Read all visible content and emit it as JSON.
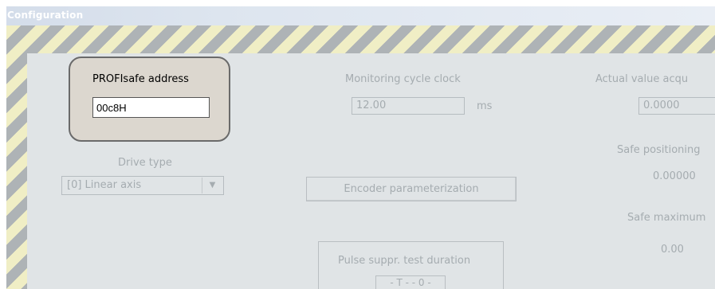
{
  "window": {
    "title": "Configuration"
  },
  "profisafe": {
    "label": "PROFIsafe address",
    "value": "00c8H"
  },
  "monitoring": {
    "label": "Monitoring cycle clock",
    "value": "12.00",
    "unit": "ms"
  },
  "actual_value": {
    "label": "Actual value acqu",
    "value": "0.0000"
  },
  "drive_type": {
    "label": "Drive type",
    "selected": "[0] Linear axis"
  },
  "encoder": {
    "button_label": "Encoder parameterization"
  },
  "safe_positioning": {
    "label": "Safe positioning",
    "value": "0.00000"
  },
  "safe_maximum": {
    "label": "Safe maximum",
    "value": "0.00"
  },
  "pulse_suppr": {
    "label": "Pulse suppr. test duration",
    "value": "- T - - 0 -"
  }
}
